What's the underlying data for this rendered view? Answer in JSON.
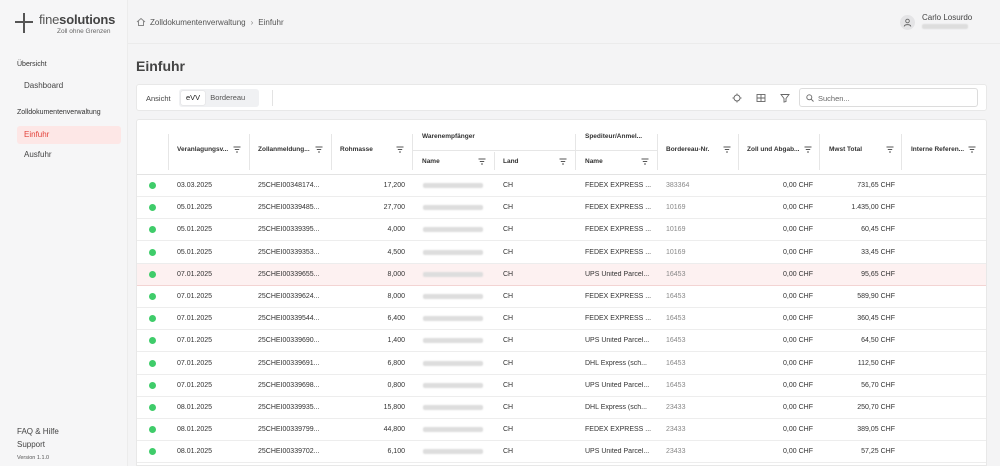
{
  "app": {
    "logo_pre": "fine",
    "logo_bold": "solutions",
    "tagline": "Zoll ohne Grenzen",
    "version": "Version 1.1.0"
  },
  "sidebar": {
    "section1": "Übersicht",
    "dashboard": "Dashboard",
    "section2": "Zolldokumentenverwaltung",
    "einfuhr": "Einfuhr",
    "ausfuhr": "Ausfuhr",
    "faq": "FAQ & Hilfe",
    "support": "Support"
  },
  "breadcrumb": [
    "Zolldokumentenverwaltung",
    "Einfuhr"
  ],
  "user": {
    "name": "Carlo Losurdo"
  },
  "page": {
    "title": "Einfuhr"
  },
  "toolbar": {
    "view_label": "Ansicht",
    "view_options": [
      "eVV",
      "Bordereau"
    ],
    "selected_view": "eVV",
    "search_placeholder": "Suchen..."
  },
  "table": {
    "columns": {
      "veranlagung": "Veranlagungsv...",
      "zollanmeldung": "Zollanmeldung...",
      "rohmasse": "Rohmasse",
      "warenempfaenger": "Warenempfänger",
      "we_name": "Name",
      "we_land": "Land",
      "spediteur": "Spediteur/Anmel...",
      "sp_name": "Name",
      "bordereau": "Bordereau-Nr.",
      "zoll": "Zoll und Abgab...",
      "mwst": "Mwst Total",
      "interne": "Interne Referen..."
    },
    "rows": [
      {
        "date": "03.03.2025",
        "zoll_id": "25CHEI00348174...",
        "mass": "17,200",
        "land": "CH",
        "spediteur": "FEDEX EXPRESS ...",
        "bordereau": "383364",
        "abgaben": "0,00 CHF",
        "mwst": "731,65 CHF"
      },
      {
        "date": "05.01.2025",
        "zoll_id": "25CHEI00339485...",
        "mass": "27,700",
        "land": "CH",
        "spediteur": "FEDEX EXPRESS ...",
        "bordereau": "10169",
        "abgaben": "0,00 CHF",
        "mwst": "1.435,00 CHF"
      },
      {
        "date": "05.01.2025",
        "zoll_id": "25CHEI00339395...",
        "mass": "4,000",
        "land": "CH",
        "spediteur": "FEDEX EXPRESS ...",
        "bordereau": "10169",
        "abgaben": "0,00 CHF",
        "mwst": "60,45 CHF"
      },
      {
        "date": "05.01.2025",
        "zoll_id": "25CHEI00339353...",
        "mass": "4,500",
        "land": "CH",
        "spediteur": "FEDEX EXPRESS ...",
        "bordereau": "10169",
        "abgaben": "0,00 CHF",
        "mwst": "33,45 CHF"
      },
      {
        "date": "07.01.2025",
        "zoll_id": "25CHEI00339655...",
        "mass": "8,000",
        "land": "CH",
        "spediteur": "UPS United Parcel...",
        "bordereau": "16453",
        "abgaben": "0,00 CHF",
        "mwst": "95,65 CHF"
      },
      {
        "date": "07.01.2025",
        "zoll_id": "25CHEI00339624...",
        "mass": "8,000",
        "land": "CH",
        "spediteur": "FEDEX EXPRESS ...",
        "bordereau": "16453",
        "abgaben": "0,00 CHF",
        "mwst": "589,90 CHF"
      },
      {
        "date": "07.01.2025",
        "zoll_id": "25CHEI00339544...",
        "mass": "6,400",
        "land": "CH",
        "spediteur": "FEDEX EXPRESS ...",
        "bordereau": "16453",
        "abgaben": "0,00 CHF",
        "mwst": "360,45 CHF"
      },
      {
        "date": "07.01.2025",
        "zoll_id": "25CHEI00339690...",
        "mass": "1,400",
        "land": "CH",
        "spediteur": "UPS United Parcel...",
        "bordereau": "16453",
        "abgaben": "0,00 CHF",
        "mwst": "64,50 CHF"
      },
      {
        "date": "07.01.2025",
        "zoll_id": "25CHEI00339691...",
        "mass": "6,800",
        "land": "CH",
        "spediteur": "DHL Express (sch...",
        "bordereau": "16453",
        "abgaben": "0,00 CHF",
        "mwst": "112,50 CHF"
      },
      {
        "date": "07.01.2025",
        "zoll_id": "25CHEI00339698...",
        "mass": "0,800",
        "land": "CH",
        "spediteur": "UPS United Parcel...",
        "bordereau": "16453",
        "abgaben": "0,00 CHF",
        "mwst": "56,70 CHF"
      },
      {
        "date": "08.01.2025",
        "zoll_id": "25CHEI00339935...",
        "mass": "15,800",
        "land": "CH",
        "spediteur": "DHL Express (sch...",
        "bordereau": "23433",
        "abgaben": "0,00 CHF",
        "mwst": "250,70 CHF"
      },
      {
        "date": "08.01.2025",
        "zoll_id": "25CHEI00339799...",
        "mass": "44,800",
        "land": "CH",
        "spediteur": "FEDEX EXPRESS ...",
        "bordereau": "23433",
        "abgaben": "0,00 CHF",
        "mwst": "389,05 CHF"
      },
      {
        "date": "08.01.2025",
        "zoll_id": "25CHEI00339702...",
        "mass": "6,100",
        "land": "CH",
        "spediteur": "UPS United Parcel...",
        "bordereau": "23433",
        "abgaben": "0,00 CHF",
        "mwst": "57,25 CHF"
      }
    ],
    "highlighted_row": 4
  },
  "colors": {
    "accent": "#e3433b",
    "status_ok": "#3fcc6a",
    "highlight": "#fdf1f1"
  }
}
